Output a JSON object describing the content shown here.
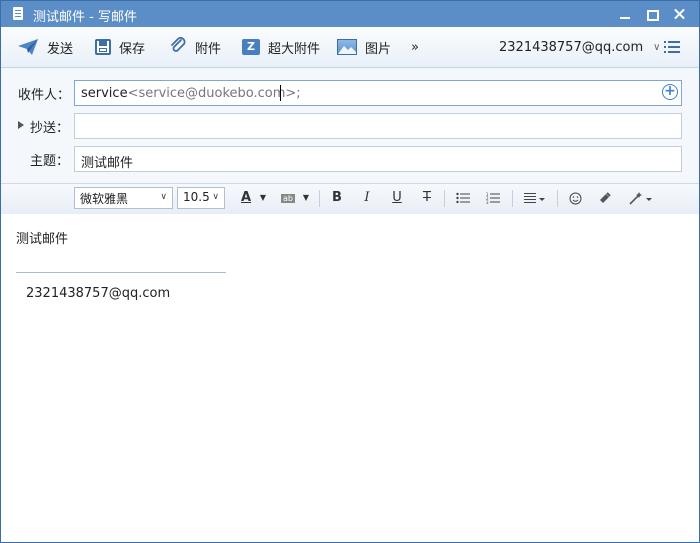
{
  "window": {
    "title": "测试邮件 - 写邮件"
  },
  "toolbar": {
    "send_label": "发送",
    "save_label": "保存",
    "attach_label": "附件",
    "big_attach_label": "超大附件",
    "picture_label": "图片",
    "more_label": "»",
    "account": "2321438757@qq.com"
  },
  "fields": {
    "to_label": "收件人：",
    "to_recipient_name": "service",
    "to_recipient_addr": "<service@duokebo.com>;",
    "cc_label": "抄送：",
    "subject_label": "主题：",
    "subject_value": "测试邮件"
  },
  "format": {
    "font": "微软雅黑",
    "size": "10.5"
  },
  "body": {
    "line1": "测试邮件",
    "signature": "2321438757@qq.com"
  },
  "colors": {
    "titlebar": "#5b8dc6",
    "accent": "#3f6ea5"
  }
}
